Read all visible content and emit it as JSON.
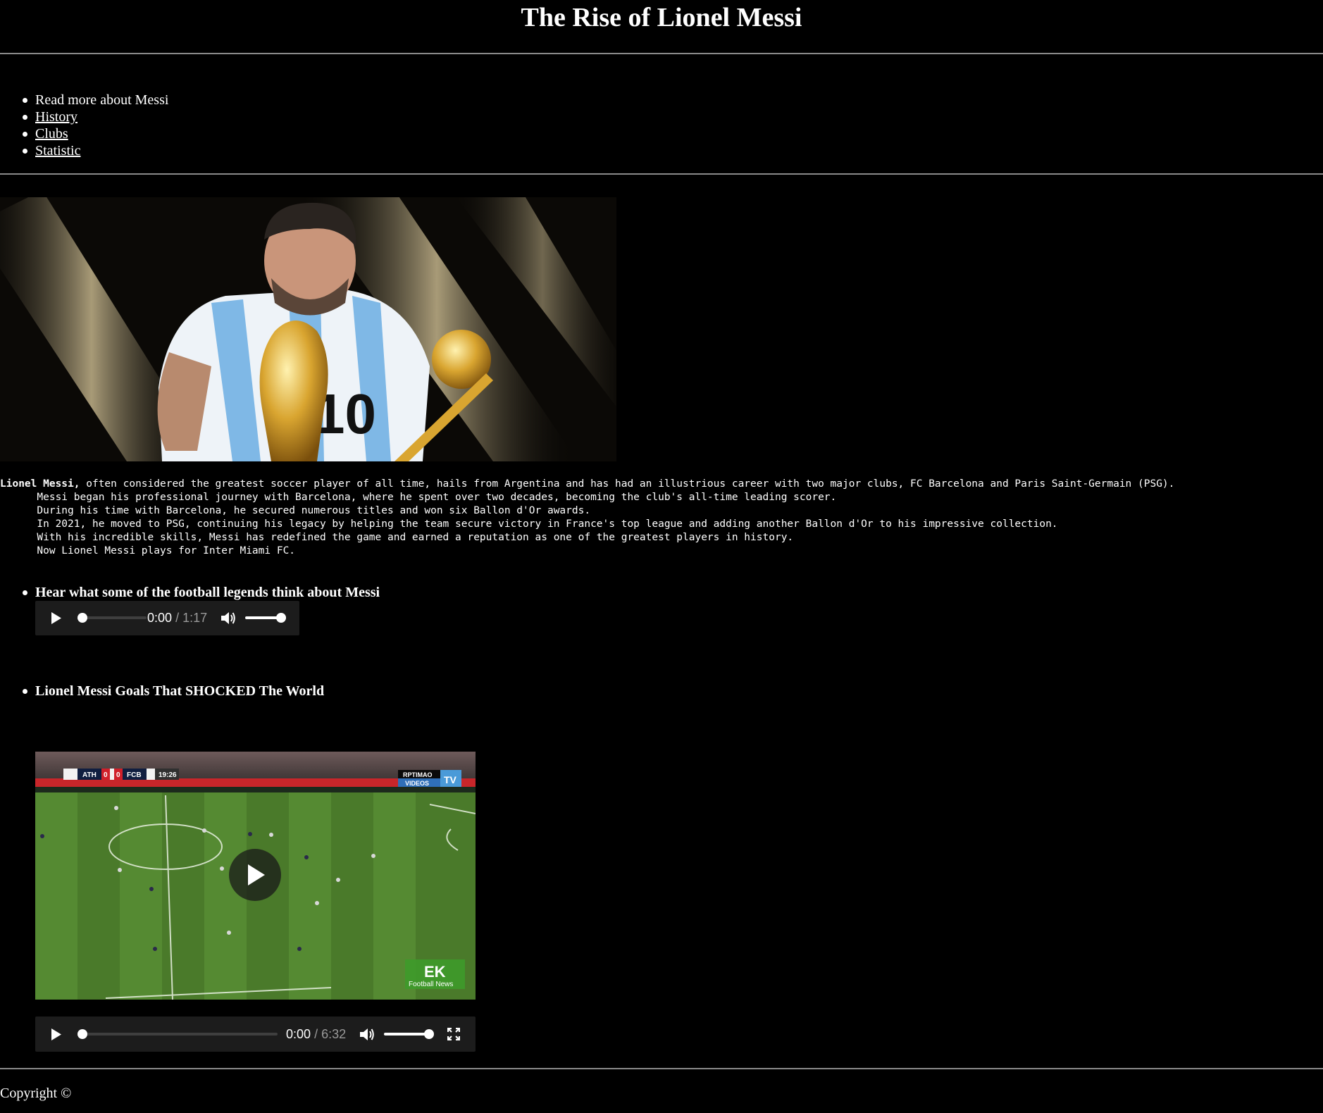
{
  "page": {
    "title": "The Rise of Lionel Messi"
  },
  "nav": {
    "items": [
      {
        "label": "Read more about Messi"
      },
      {
        "label": "History"
      },
      {
        "label": "Clubs"
      },
      {
        "label": "Statistic"
      }
    ]
  },
  "bio": {
    "name": "Lionel Messi,",
    "line1": " often considered the greatest soccer player of all time, hails from Argentina and has had an illustrious career with two major clubs, FC Barcelona and Paris Saint-Germain (PSG).",
    "line2": "Messi began his professional journey with Barcelona, where he spent over two decades, becoming the club's all-time leading scorer.",
    "line3": "During his time with Barcelona, he secured numerous titles and won six Ballon d'Or awards.",
    "line4": "In 2021, he moved to PSG, continuing his legacy by helping the team secure victory in France's top league and adding another Ballon d'Or to his impressive collection.",
    "line5": "With his incredible skills, Messi has redefined the game and earned a reputation as one of the greatest players in history.",
    "line6": "Now Lionel Messi plays for Inter Miami FC."
  },
  "audio": {
    "heading": "Hear what some of the football legends think about Messi",
    "current": "0:00",
    "duration": "/ 1:17",
    "progress": 0,
    "volume": 1
  },
  "video": {
    "heading": "Lionel Messi Goals That SHOCKED The World",
    "current": "0:00",
    "duration": "/ 6:32",
    "progress": 0,
    "volume": 1,
    "scoreboard": {
      "home": "ATH",
      "home_score": "0",
      "away_score": "0",
      "away": "FCB",
      "clock": "19:26"
    },
    "watermark_top_a": "RPTIMAO",
    "watermark_top_b": "VIDEOS",
    "watermark_top_c": "TV",
    "watermark_bottom_a": "EK",
    "watermark_bottom_b": "Football News"
  },
  "footer": {
    "copyright": "Copyright ©"
  },
  "colors": {
    "background": "#000000",
    "text": "#ffffff",
    "player": "#1c1c1c",
    "rule": "#8a8a8a"
  },
  "icons": [
    "play-icon",
    "volume-icon",
    "fullscreen-icon"
  ]
}
